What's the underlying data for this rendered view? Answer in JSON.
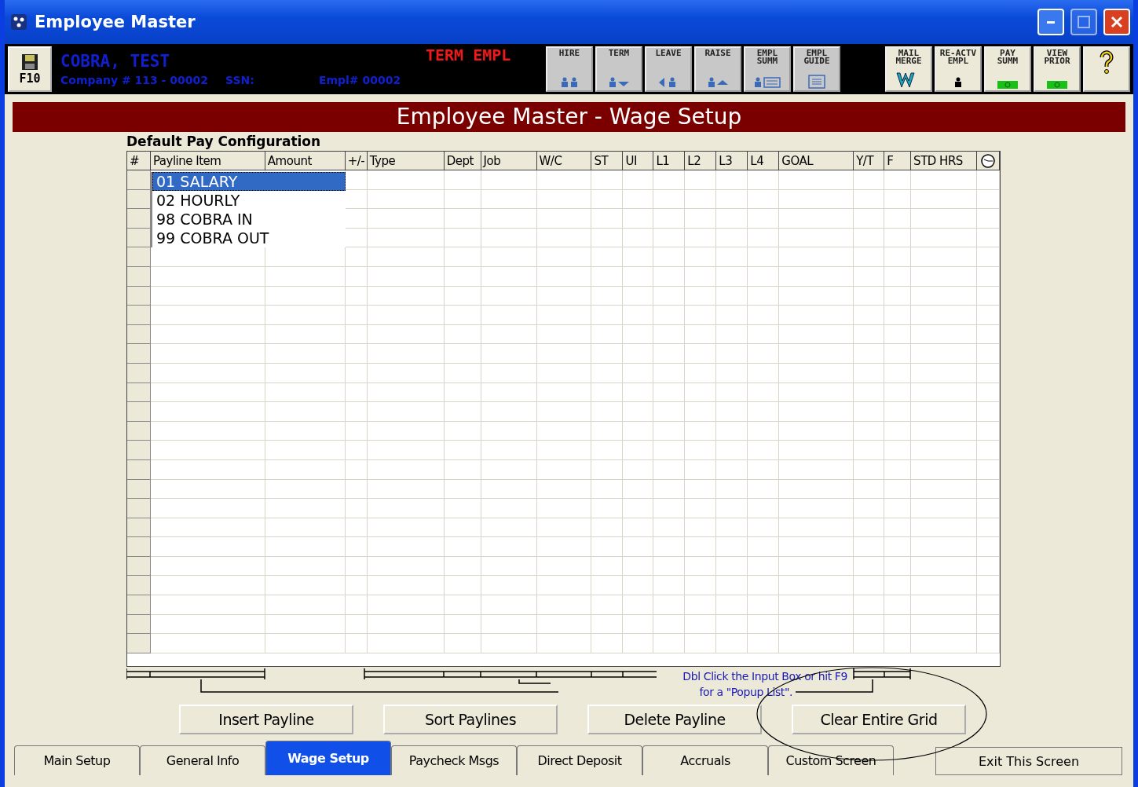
{
  "window": {
    "title": "Employee Master"
  },
  "header": {
    "save_key": "F10",
    "employee_name": "COBRA, TEST",
    "company": "Company # 113 - 00002",
    "ssn": "SSN:",
    "empl_no": "Empl# 00002",
    "status": "TERM EMPL"
  },
  "toolbar_left": [
    {
      "lines": [
        "HIRE"
      ],
      "kind": "hire"
    },
    {
      "lines": [
        "TERM"
      ],
      "kind": "term"
    },
    {
      "lines": [
        "LEAVE"
      ],
      "kind": "leave"
    },
    {
      "lines": [
        "RAISE"
      ],
      "kind": "raise"
    },
    {
      "lines": [
        "EMPL",
        "SUMM"
      ],
      "kind": "summ"
    },
    {
      "lines": [
        "EMPL",
        "GUIDE"
      ],
      "kind": "guide"
    }
  ],
  "toolbar_right": [
    {
      "lines": [
        "MAIL",
        "MERGE"
      ],
      "kind": "merge"
    },
    {
      "lines": [
        "RE-ACTV",
        "EMPL"
      ],
      "kind": "reactivate"
    },
    {
      "lines": [
        "PAY",
        "SUMM"
      ],
      "kind": "money"
    },
    {
      "lines": [
        "VIEW",
        "PRIOR"
      ],
      "kind": "money"
    },
    {
      "kind": "help"
    }
  ],
  "page_title": "Employee Master - Wage Setup",
  "section_title": "Default Pay Configuration",
  "table": {
    "columns": [
      "#",
      "Payline Item",
      "Amount",
      "+/-",
      "Type",
      "Dept",
      "Job",
      "W/C",
      "ST",
      "UI",
      "L1",
      "L2",
      "L3",
      "L4",
      "GOAL",
      "Y/T",
      "F",
      "STD HRS"
    ],
    "popup_list": [
      {
        "label": "01 SALARY",
        "selected": true
      },
      {
        "label": "02 HOURLY",
        "selected": false
      },
      {
        "label": "98 COBRA IN",
        "selected": false
      },
      {
        "label": "99 COBRA OUT",
        "selected": false
      }
    ]
  },
  "hint": [
    "Dbl Click the Input Box or hit F9",
    "for a \"Popup List\"."
  ],
  "buttons": [
    "Insert Payline",
    "Sort Paylines",
    "Delete Payline",
    "Clear Entire Grid"
  ],
  "tabs": [
    {
      "label": "Main Setup",
      "selected": false
    },
    {
      "label": "General Info",
      "selected": false
    },
    {
      "label": "Wage Setup",
      "selected": true
    },
    {
      "label": "Paycheck Msgs",
      "selected": false
    },
    {
      "label": "Direct Deposit",
      "selected": false
    },
    {
      "label": "Accruals",
      "selected": false
    },
    {
      "label": "Custom Screen",
      "selected": false
    }
  ],
  "exit_button": "Exit This Screen"
}
